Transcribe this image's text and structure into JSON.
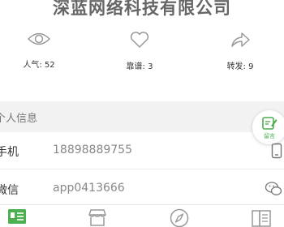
{
  "header": {
    "company_name": "深蓝网络科技有限公司"
  },
  "stats": {
    "views": "人气: 52",
    "likes": "靠谱: 3",
    "shares": "转发: 9"
  },
  "section": {
    "title": "个人信息"
  },
  "contact": {
    "phone_label": "手机",
    "phone_value": "18898889755",
    "wechat_label": "微信",
    "wechat_value": "app0413666"
  },
  "floating_button": {
    "label": "留言"
  },
  "tabbar": {
    "items": [
      {
        "icon": "card-icon",
        "active": true
      },
      {
        "icon": "shop-icon",
        "active": false
      },
      {
        "icon": "compass-icon",
        "active": false
      },
      {
        "icon": "news-icon",
        "active": false
      }
    ]
  },
  "colors": {
    "accent": "#4caf50",
    "icon_gray": "#999999"
  }
}
